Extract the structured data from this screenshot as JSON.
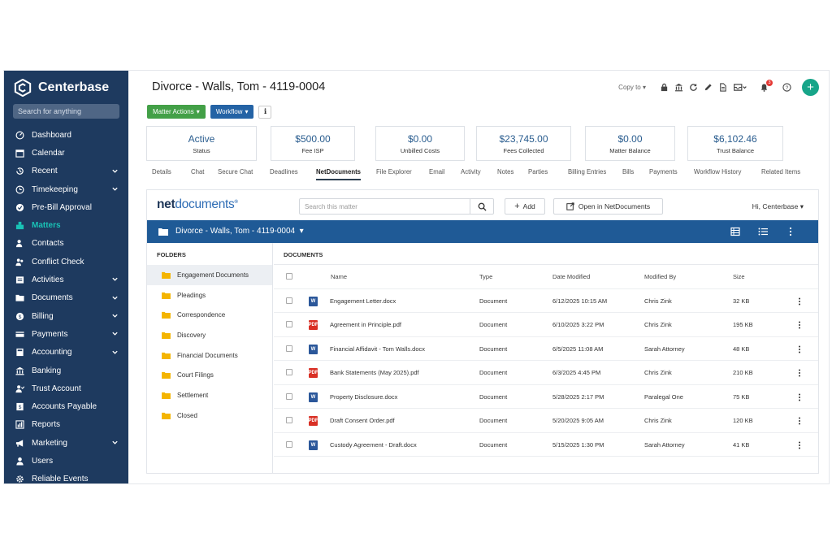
{
  "sidebar": {
    "brand": "Centerbase",
    "search_placeholder": "Search for anything",
    "items": [
      {
        "label": "Dashboard",
        "icon": "dashboard-icon",
        "chevron": false
      },
      {
        "label": "Calendar",
        "icon": "calendar-icon",
        "chevron": false
      },
      {
        "label": "Recent",
        "icon": "history-icon",
        "chevron": true
      },
      {
        "label": "Timekeeping",
        "icon": "clock-icon",
        "chevron": true
      },
      {
        "label": "Pre-Bill Approval",
        "icon": "approval-icon",
        "chevron": false
      },
      {
        "label": "Matters",
        "icon": "matters-icon",
        "chevron": false,
        "active": true
      },
      {
        "label": "Contacts",
        "icon": "contacts-icon",
        "chevron": false
      },
      {
        "label": "Conflict Check",
        "icon": "conflict-icon",
        "chevron": false
      },
      {
        "label": "Activities",
        "icon": "activities-icon",
        "chevron": true
      },
      {
        "label": "Documents",
        "icon": "folder-icon",
        "chevron": true
      },
      {
        "label": "Billing",
        "icon": "billing-icon",
        "chevron": true
      },
      {
        "label": "Payments",
        "icon": "payments-icon",
        "chevron": true
      },
      {
        "label": "Accounting",
        "icon": "accounting-icon",
        "chevron": true
      },
      {
        "label": "Banking",
        "icon": "bank-icon",
        "chevron": false
      },
      {
        "label": "Trust Account",
        "icon": "trust-icon",
        "chevron": false
      },
      {
        "label": "Accounts Payable",
        "icon": "payable-icon",
        "chevron": false
      },
      {
        "label": "Reports",
        "icon": "reports-icon",
        "chevron": false
      },
      {
        "label": "Marketing",
        "icon": "megaphone-icon",
        "chevron": true
      },
      {
        "label": "Users",
        "icon": "user-icon",
        "chevron": false
      },
      {
        "label": "Reliable Events",
        "icon": "gear-icon",
        "chevron": false
      }
    ]
  },
  "header": {
    "title": "Divorce - Walls, Tom - 4119-0004",
    "copy_to": "Copy to",
    "notification_count": "3",
    "matter_actions": "Matter Actions",
    "workflow": "Workflow"
  },
  "stats": [
    {
      "value": "Active",
      "label": "Status"
    },
    {
      "value": "$500.00",
      "label": "Fee ISP"
    },
    {
      "value": "$0.00",
      "label": "Unbilled Costs"
    },
    {
      "value": "$23,745.00",
      "label": "Fees Collected"
    },
    {
      "value": "$0.00",
      "label": "Matter Balance"
    },
    {
      "value": "$6,102.46",
      "label": "Trust Balance"
    }
  ],
  "tabs": [
    "Details",
    "Chat",
    "Secure Chat",
    "Deadlines",
    "NetDocuments",
    "File Explorer",
    "Email",
    "Activity",
    "Notes",
    "Parties",
    "Billing Entries",
    "Bills",
    "Payments",
    "Workflow History",
    "Related Items"
  ],
  "active_tab": "NetDocuments",
  "netdocs": {
    "logo_bold": "net",
    "logo_thin": "documents",
    "search_placeholder": "Search this matter",
    "add_label": "Add",
    "open_label": "Open in NetDocuments",
    "greeting": "Hi, Centerbase",
    "matter_bar": "Divorce - Walls, Tom - 4119-0004",
    "folders_header": "FOLDERS",
    "folders": [
      "Engagement Documents",
      "Pleadings",
      "Correspondence",
      "Discovery",
      "Financial Documents",
      "Court Filings",
      "Settlement",
      "Closed"
    ],
    "selected_folder": "Engagement Documents",
    "documents_header": "DOCUMENTS",
    "columns": {
      "name": "Name",
      "type": "Type",
      "date": "Date Modified",
      "by": "Modified By",
      "size": "Size"
    },
    "rows": [
      {
        "file": "word",
        "name": "Engagement Letter.docx",
        "type": "Document",
        "date": "6/12/2025 10:15 AM",
        "by": "Chris Zink",
        "size": "32 KB"
      },
      {
        "file": "pdf",
        "name": "Agreement in Principle.pdf",
        "type": "Document",
        "date": "6/10/2025 3:22 PM",
        "by": "Chris Zink",
        "size": "195 KB"
      },
      {
        "file": "word",
        "name": "Financial Affidavit - Tom Walls.docx",
        "type": "Document",
        "date": "6/5/2025 11:08 AM",
        "by": "Sarah Attorney",
        "size": "48 KB"
      },
      {
        "file": "pdf",
        "name": "Bank Statements (May 2025).pdf",
        "type": "Document",
        "date": "6/3/2025 4:45 PM",
        "by": "Chris Zink",
        "size": "210 KB"
      },
      {
        "file": "word",
        "name": "Property Disclosure.docx",
        "type": "Document",
        "date": "5/28/2025 2:17 PM",
        "by": "Paralegal One",
        "size": "75 KB"
      },
      {
        "file": "pdf",
        "name": "Draft Consent Order.pdf",
        "type": "Document",
        "date": "5/20/2025 9:05 AM",
        "by": "Chris Zink",
        "size": "120 KB"
      },
      {
        "file": "word",
        "name": "Custody Agreement - Draft.docx",
        "type": "Document",
        "date": "5/15/2025 1:30 PM",
        "by": "Sarah Attorney",
        "size": "41 KB"
      }
    ]
  },
  "colors": {
    "sidebar": "#1e3a5f",
    "accent_teal": "#19c2b6",
    "nd_bar": "#1f5a96",
    "green": "#43a047",
    "blue": "#2463a5"
  }
}
